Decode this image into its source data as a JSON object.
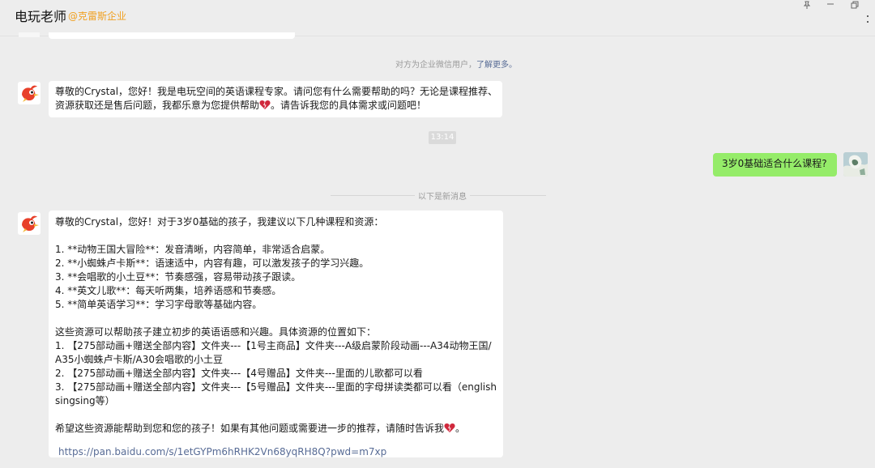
{
  "header": {
    "contact_name": "电玩老师",
    "corp_tag": "@克雷斯企业",
    "controls": [
      "pin-icon",
      "minimize-icon",
      "maximize-icon",
      "close-icon"
    ]
  },
  "system_note": {
    "text": "对方为企业微信用户，",
    "link": "了解更多。"
  },
  "messages": {
    "greeting": {
      "lines": [
        "尊敬的Crystal，您好！我是电玩空间的英语课程专家。请问您有什么需要帮助的吗？无论是课程推荐、",
        "资源获取还是售后问题，我都乐意为您提供帮助",
        "。请告诉我您的具体需求或问题吧！"
      ]
    },
    "timestamp": "13:14",
    "user_question": "3岁0基础适合什么课程?",
    "divider": "以下是新消息",
    "answer": {
      "intro": "尊敬的Crystal，您好！对于3岁0基础的孩子，我建议以下几种课程和资源：",
      "items": [
        "1. **动物王国大冒险**：发音清晰，内容简单，非常适合启蒙。",
        "2. **小蜘蛛卢卡斯**：语速适中，内容有趣，可以激发孩子的学习兴趣。",
        "3. **会唱歌的小土豆**：节奏感强，容易带动孩子跟读。",
        "4. **英文儿歌**：每天听两集，培养语感和节奏感。",
        "5. **简单英语学习**：学习字母歌等基础内容。"
      ],
      "resources_intro": "这些资源可以帮助孩子建立初步的英语语感和兴趣。具体资源的位置如下：",
      "resources": [
        "1. 【275部动画+赠送全部内容】文件夹---【1号主商品】文件夹---A级启蒙阶段动画---A34动物王国/",
        "A35小蜘蛛卢卡斯/A30会唱歌的小土豆",
        "2. 【275部动画+赠送全部内容】文件夹---【4号赠品】文件夹---里面的儿歌都可以看",
        "3. 【275部动画+赠送全部内容】文件夹---【5号赠品】文件夹---里面的字母拼读类都可以看（english",
        "singsing等）"
      ],
      "closing": "希望这些资源能帮助到您和您的孩子！如果有其他问题或需要进一步的推荐，请随时告诉我",
      "closing_end": "。",
      "link": "https://pan.baidu.com/s/1etGYPm6hRHK2Vn68yqRH8Q?pwd=m7xp"
    }
  },
  "colors": {
    "background": "#ededed",
    "mine_bubble": "#95ec69",
    "corp_tag": "#f0a020",
    "link": "#576b95",
    "heart": "#d0283c"
  }
}
